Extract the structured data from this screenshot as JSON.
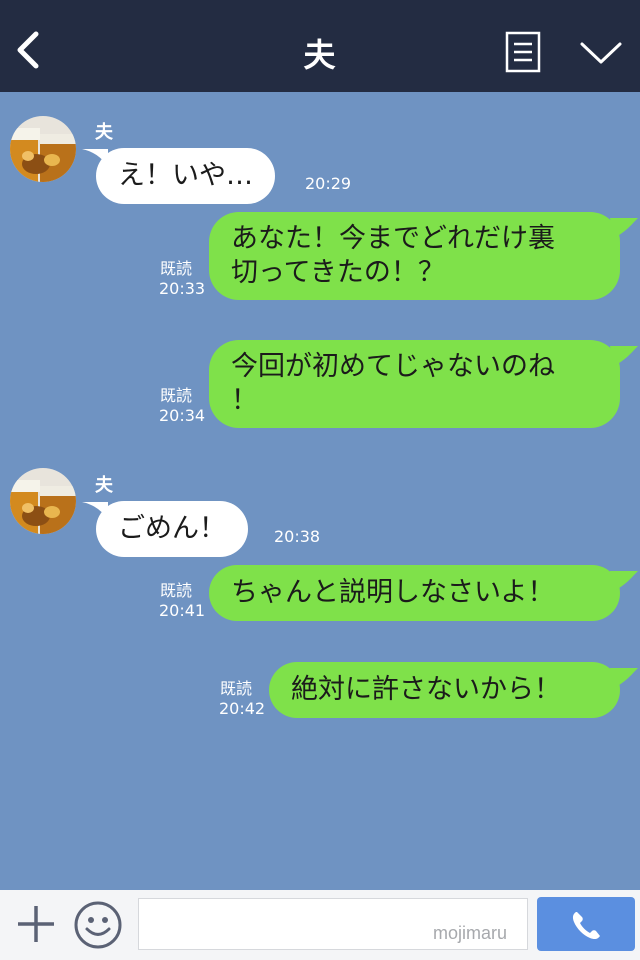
{
  "header": {
    "title": "夫",
    "back_icon": "chevron-left-icon",
    "menu_icon": "notes-icon",
    "collapse_icon": "chevron-down-icon"
  },
  "messages": [
    {
      "direction": "in",
      "sender": "夫",
      "text": "え！いや…",
      "time": "20:29"
    },
    {
      "direction": "out",
      "read": "既読",
      "text_lines": [
        "あなた！今までどれだけ裏",
        "切ってきたの！？"
      ],
      "time": "20:33"
    },
    {
      "direction": "out",
      "read": "既読",
      "text_lines": [
        "今回が初めてじゃないのね",
        "！"
      ],
      "time": "20:34"
    },
    {
      "direction": "in",
      "sender": "夫",
      "text": "ごめん！",
      "time": "20:38"
    },
    {
      "direction": "out",
      "read": "既読",
      "text": "ちゃんと説明しなさいよ！",
      "time": "20:41"
    },
    {
      "direction": "out",
      "read": "既読",
      "text": "絶対に許さないから！",
      "time": "20:42"
    }
  ],
  "footer": {
    "plus_icon": "plus-icon",
    "emoji_icon": "smiley-icon",
    "input_value": "",
    "watermark": "mojimaru",
    "call_icon": "phone-icon"
  },
  "colors": {
    "header_bg": "#232c42",
    "chat_bg": "#6f93c2",
    "outgoing_bubble": "#7fe14a",
    "incoming_bubble": "#ffffff",
    "call_button": "#5b8fe0"
  }
}
